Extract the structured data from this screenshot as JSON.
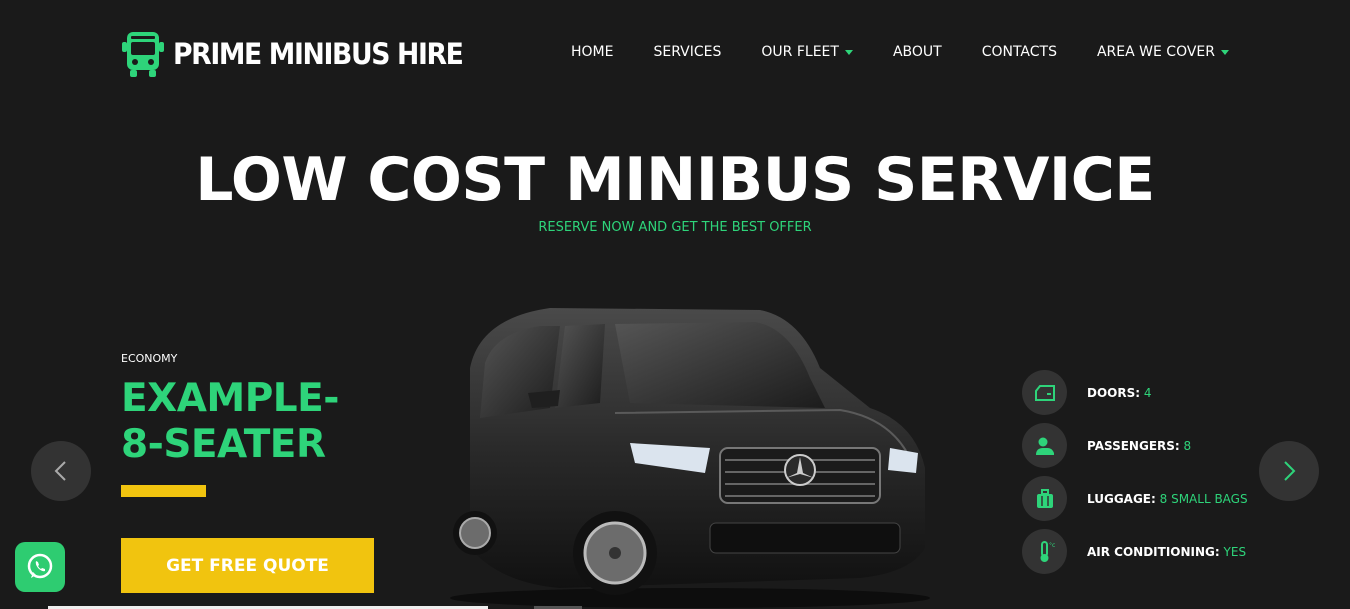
{
  "brand": {
    "name": "PRIME MINIBUS HIRE",
    "icon": "bus-icon",
    "accent_color": "#2ed47a"
  },
  "nav": {
    "items": [
      {
        "label": "HOME",
        "dropdown": false
      },
      {
        "label": "SERVICES",
        "dropdown": false
      },
      {
        "label": "OUR FLEET",
        "dropdown": true
      },
      {
        "label": "ABOUT",
        "dropdown": false
      },
      {
        "label": "CONTACTS",
        "dropdown": false
      },
      {
        "label": "AREA WE COVER",
        "dropdown": true
      }
    ]
  },
  "hero": {
    "title": "LOW COST MINIBUS SERVICE",
    "subtitle": "RESERVE NOW AND GET THE BEST OFFER"
  },
  "vehicle": {
    "category": "ECONOMY",
    "name": "EXAMPLE-8-SEATER",
    "quote_button": "GET FREE QUOTE",
    "button_color": "#f1c40f"
  },
  "specs": [
    {
      "icon": "car-door-icon",
      "label": "DOORS:",
      "value": "4"
    },
    {
      "icon": "passenger-icon",
      "label": "PASSENGERS:",
      "value": "8"
    },
    {
      "icon": "luggage-icon",
      "label": "LUGGAGE:",
      "value": "8 SMALL BAGS"
    },
    {
      "icon": "thermometer-icon",
      "label": "AIR CONDITIONING:",
      "value": "YES"
    }
  ],
  "carousel": {
    "prev_icon": "chevron-left-icon",
    "next_icon": "chevron-right-icon"
  },
  "chat": {
    "icon": "whatsapp-icon"
  }
}
